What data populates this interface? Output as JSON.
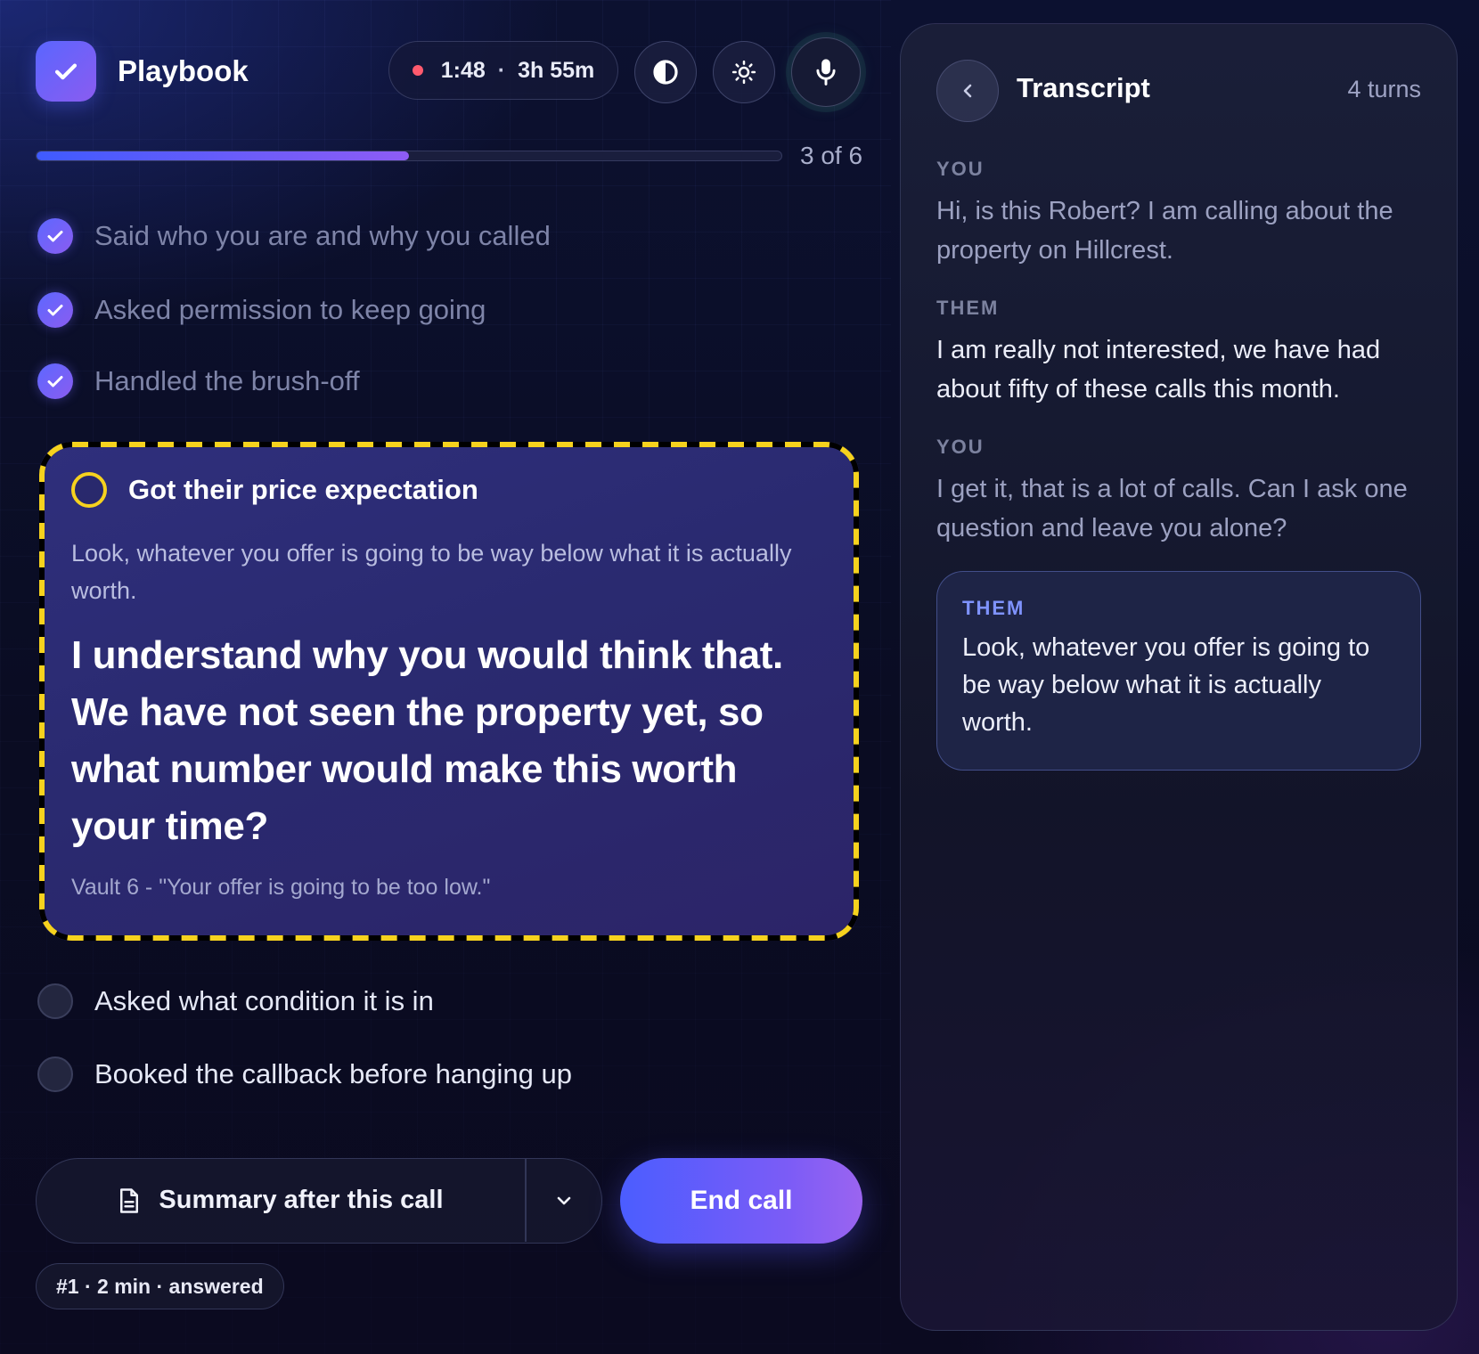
{
  "header": {
    "app_title": "Playbook",
    "timer": {
      "elapsed": "1:48",
      "separator": "·",
      "remaining": "3h 55m"
    }
  },
  "progress": {
    "label": "3 of 6",
    "fraction": 0.5
  },
  "steps": [
    {
      "label": "Said who you are and why you called",
      "status": "done"
    },
    {
      "label": "Asked permission to keep going",
      "status": "done"
    },
    {
      "label": "Handled the brush-off",
      "status": "done"
    },
    {
      "label": "Got their price expectation",
      "status": "active"
    },
    {
      "label": "Asked what condition it is in",
      "status": "todo"
    },
    {
      "label": "Booked the callback before hanging up",
      "status": "todo"
    }
  ],
  "active_card": {
    "quote": "Look, whatever you offer is going to be way below what it is actually worth.",
    "response": "I understand why you would think that. We have not seen the property yet, so what number would make this worth your time?",
    "source": "Vault 6 - \"Your offer is going to be too low.\""
  },
  "controls": {
    "summary_label": "Summary after this call",
    "end_call_label": "End call",
    "call_tag": "#1 · 2 min · answered"
  },
  "transcript": {
    "title": "Transcript",
    "count": "4 turns",
    "turns": [
      {
        "speaker": "YOU",
        "text": "Hi, is this Robert? I am calling about the property on Hillcrest."
      },
      {
        "speaker": "THEM",
        "text": "I am really not interested, we have had about fifty of these calls this month."
      },
      {
        "speaker": "YOU",
        "text": "I get it, that is a lot of calls. Can I ask one question and leave you alone?"
      },
      {
        "speaker": "THEM",
        "text": "Look, whatever you offer is going to be way below what it is actually worth."
      }
    ]
  },
  "colors": {
    "accent": "#5d68ff",
    "accent_2": "#8a5cf0",
    "hazard_yellow": "#f6d21e",
    "recording_dot": "#ff5a6e",
    "live_speaker": "#7f93ff"
  },
  "icons": {
    "brand": "check-icon",
    "contrast": "contrast-icon",
    "brightness": "sun-icon",
    "microphone": "microphone-icon",
    "summary": "document-icon",
    "dropdown": "chevron-down-icon",
    "back": "chevron-left-icon"
  }
}
